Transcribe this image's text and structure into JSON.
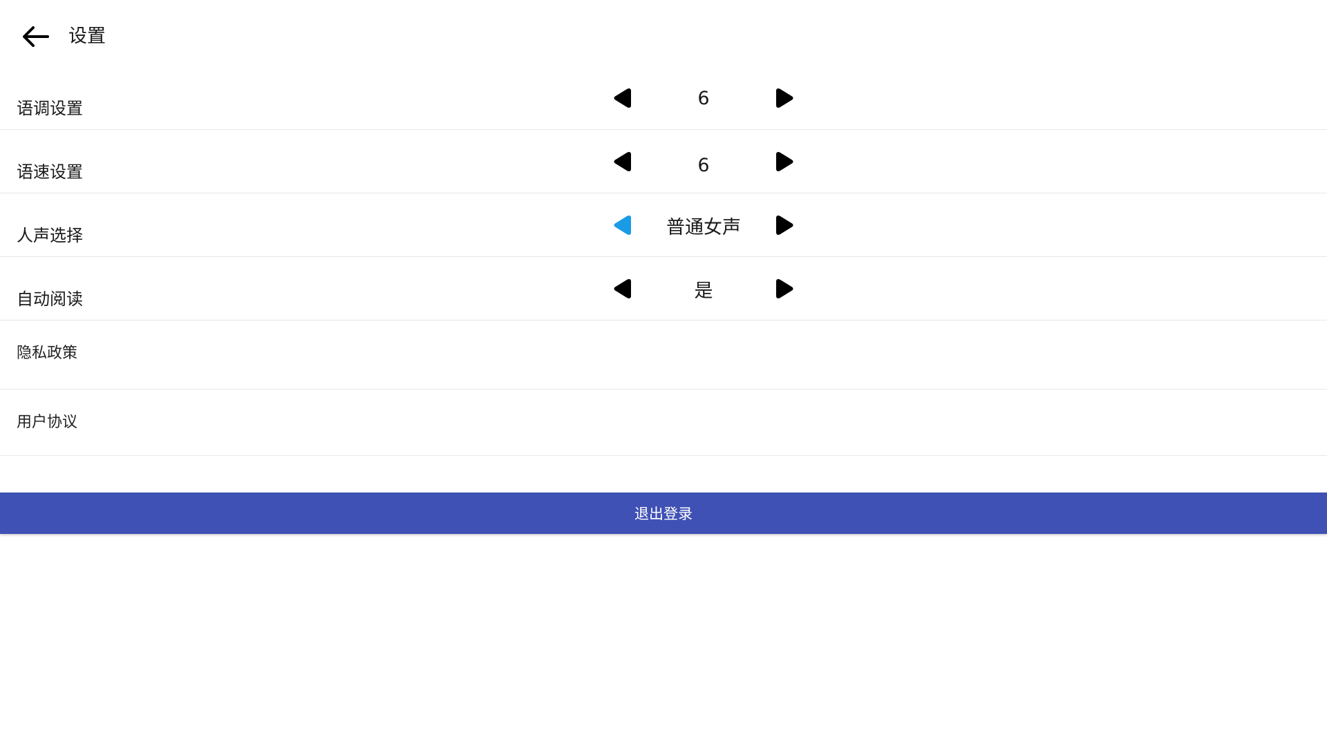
{
  "header": {
    "title": "设置",
    "back_icon": "arrow-left-icon"
  },
  "settings": [
    {
      "label": "语调设置",
      "value": "6",
      "prev_color": "#000000",
      "next_color": "#000000"
    },
    {
      "label": "语速设置",
      "value": "6",
      "prev_color": "#000000",
      "next_color": "#000000"
    },
    {
      "label": "人声选择",
      "value": "普通女声",
      "prev_color": "#1a9be6",
      "next_color": "#000000"
    },
    {
      "label": "自动阅读",
      "value": "是",
      "prev_color": "#000000",
      "next_color": "#000000"
    }
  ],
  "links": [
    {
      "label": "隐私政策"
    },
    {
      "label": "用户协议"
    }
  ],
  "logout": {
    "label": "退出登录",
    "color": "#3f51b5"
  }
}
